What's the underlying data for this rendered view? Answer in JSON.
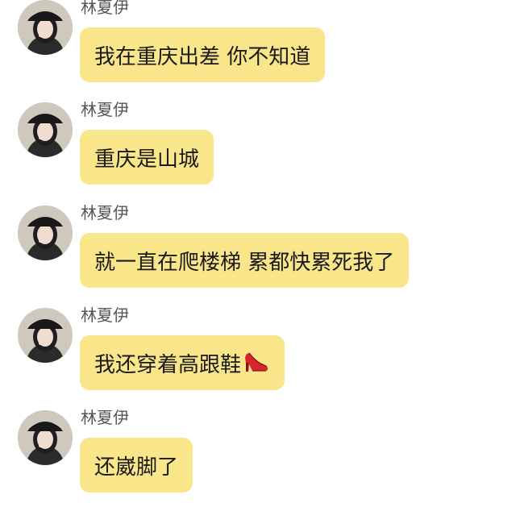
{
  "chat": {
    "messages": [
      {
        "sender": "林夏伊",
        "text": "我在重庆出差 你不知道"
      },
      {
        "sender": "林夏伊",
        "text": "重庆是山城"
      },
      {
        "sender": "林夏伊",
        "text": "就一直在爬楼梯 累都快累死我了"
      },
      {
        "sender": "林夏伊",
        "text": "我还穿着高跟鞋",
        "emoji": "high-heel-shoe-icon"
      },
      {
        "sender": "林夏伊",
        "text": "还崴脚了"
      }
    ]
  },
  "colors": {
    "bubble": "#f9e58a",
    "sender_text": "#555555",
    "message_text": "#1a1a1a",
    "background": "#ffffff"
  }
}
